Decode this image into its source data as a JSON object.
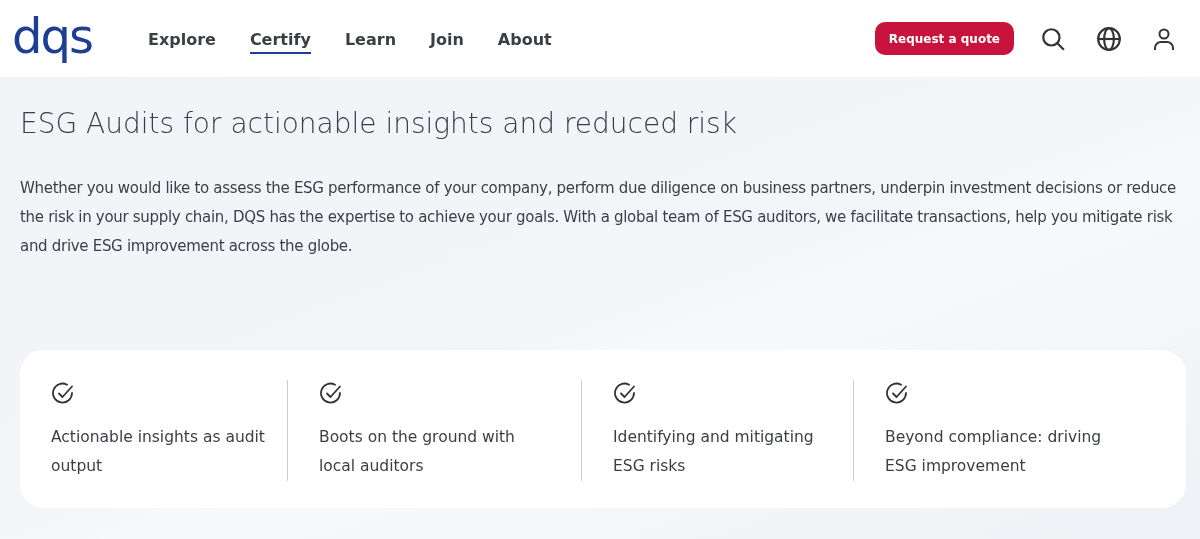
{
  "header": {
    "logo": "dqs",
    "nav": [
      {
        "label": "Explore",
        "selected": false
      },
      {
        "label": "Certify",
        "selected": true
      },
      {
        "label": "Learn",
        "selected": false
      },
      {
        "label": "Join",
        "selected": false
      },
      {
        "label": "About",
        "selected": false
      }
    ],
    "cta": "Request a quote"
  },
  "hero": {
    "title": "ESG Audits for actionable insights and reduced risk",
    "text": "Whether you would like to assess the ESG performance of your company, perform due diligence on business partners, underpin investment decisions or reduce the risk in your supply chain, DQS has the expertise to achieve your goals.  With a global team of ESG auditors, we facilitate transactions, help you mitigate risk and drive ESG improvement across the globe."
  },
  "features": [
    {
      "text": "Actionable insights as audit output"
    },
    {
      "text": "Boots on the ground with local auditors"
    },
    {
      "text": "Identifying and mitigating ESG risks"
    },
    {
      "text": "Beyond compliance: driving ESG improvement"
    }
  ]
}
